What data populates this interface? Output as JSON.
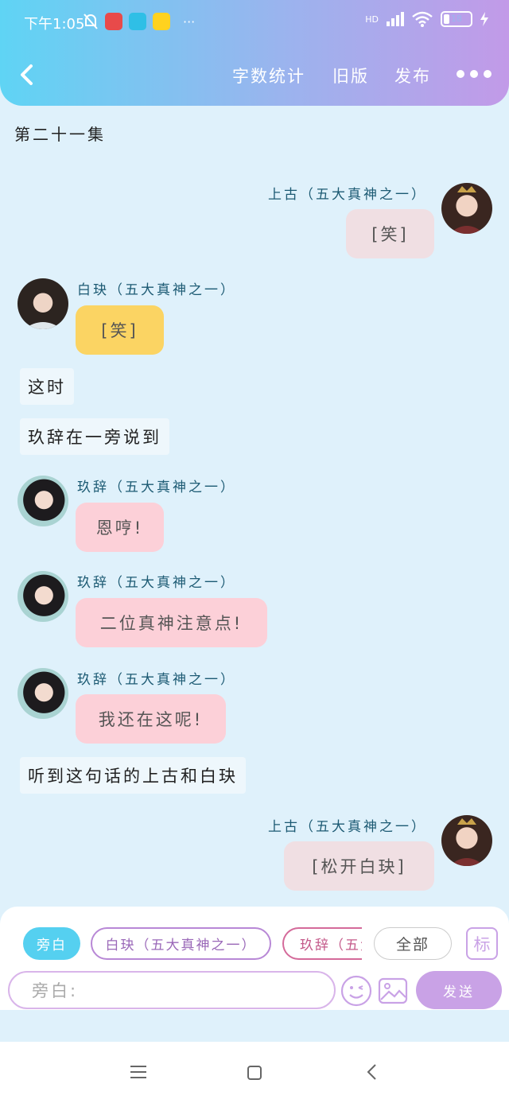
{
  "status_bar": {
    "time": "下午1:05",
    "more": "···",
    "network": "HD",
    "battery": "18"
  },
  "header": {
    "nav": [
      "字数统计",
      "旧版",
      "发布"
    ]
  },
  "chapter_title": "第二十一集",
  "messages": [
    {
      "type": "right",
      "speaker": "上古（五大真神之一）",
      "text": "[笑]"
    },
    {
      "type": "left",
      "speaker": "白玦（五大真神之一）",
      "text": "[笑]"
    },
    {
      "type": "narration",
      "text": "这时"
    },
    {
      "type": "narration",
      "text": "玖辞在一旁说到"
    },
    {
      "type": "left",
      "speaker": "玖辞（五大真神之一）",
      "text": "恩哼!"
    },
    {
      "type": "left",
      "speaker": "玖辞（五大真神之一）",
      "text": "二位真神注意点!"
    },
    {
      "type": "left",
      "speaker": "玖辞（五大真神之一）",
      "text": "我还在这呢!"
    },
    {
      "type": "narration",
      "text": "听到这句话的上古和白玦"
    },
    {
      "type": "right",
      "speaker": "上古（五大真神之一）",
      "text": "[松开白玦]"
    }
  ],
  "composer": {
    "chips": [
      "旁白",
      "白玦（五大真神之一）",
      "玖辞（五大",
      "全部",
      "标"
    ],
    "input_placeholder": "旁白:",
    "send_label": "发送"
  },
  "colors": {
    "background": "#dff1fb",
    "header_gradient": [
      "#5fd4f4",
      "#c29ae8"
    ],
    "shanggu_bubble": "#f0dfe3",
    "baijue_bubble": "#fbd463",
    "jiuci_bubble": "#fcd0d8",
    "accent_cyan": "#55d0f0",
    "send_button": "#c9a2e6"
  }
}
